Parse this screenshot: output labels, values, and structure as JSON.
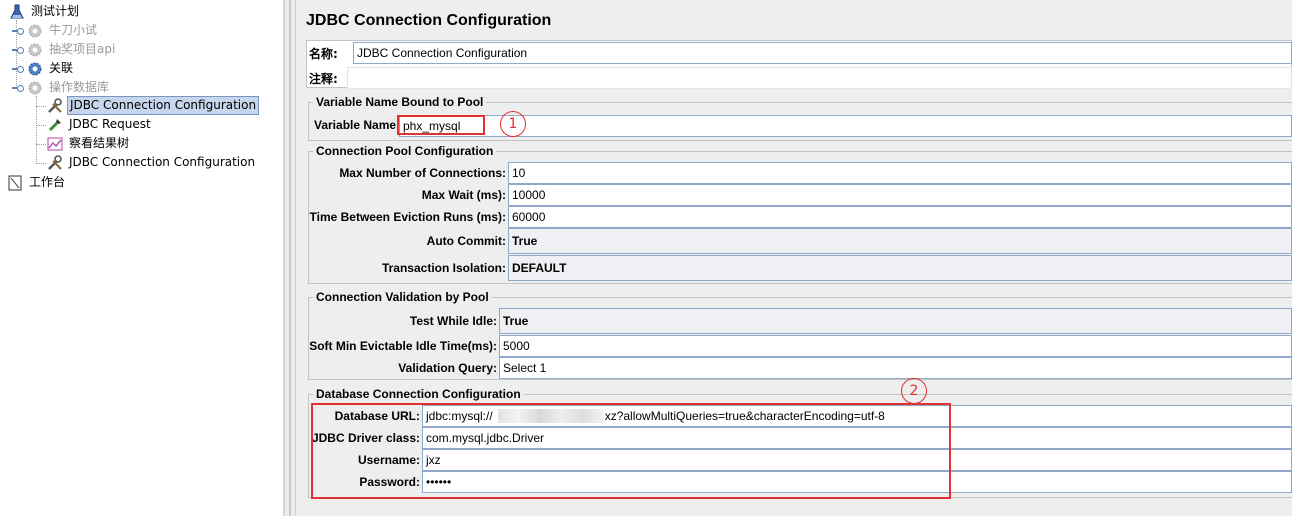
{
  "tree": {
    "root": "测试计划",
    "items": [
      {
        "label": "牛刀小试",
        "disabled": true
      },
      {
        "label": "抽奖项目api",
        "disabled": true
      },
      {
        "label": "关联",
        "disabled": false
      },
      {
        "label": "操作数据库",
        "disabled": true
      }
    ],
    "children": [
      {
        "label": "JDBC Connection Configuration",
        "selected": true
      },
      {
        "label": "JDBC Request",
        "selected": false
      },
      {
        "label": "察看结果树",
        "selected": false
      },
      {
        "label": "JDBC Connection Configuration",
        "selected": false
      }
    ],
    "workbench": "工作台"
  },
  "panel": {
    "title": "JDBC Connection Configuration",
    "name_label": "名称:",
    "name_value": "JDBC Connection Configuration",
    "comment_label": "注释:",
    "comment_value": ""
  },
  "pool_binding": {
    "title": "Variable Name Bound to Pool",
    "variable_label": "Variable Name:",
    "variable_value": "phx_mysql"
  },
  "pool_config": {
    "title": "Connection Pool Configuration",
    "rows": [
      {
        "label": "Max Number of Connections:",
        "value": "10"
      },
      {
        "label": "Max Wait (ms):",
        "value": "10000"
      },
      {
        "label": "Time Between Eviction Runs (ms):",
        "value": "60000"
      },
      {
        "label": "Auto Commit:",
        "value": "True"
      },
      {
        "label": "Transaction Isolation:",
        "value": "DEFAULT"
      }
    ]
  },
  "validation": {
    "title": "Connection Validation by Pool",
    "rows": [
      {
        "label": "Test While Idle:",
        "value": "True"
      },
      {
        "label": "Soft Min Evictable Idle Time(ms):",
        "value": "5000"
      },
      {
        "label": "Validation Query:",
        "value": "Select 1"
      }
    ]
  },
  "database": {
    "title": "Database Connection Configuration",
    "rows": [
      {
        "label": "Database URL:",
        "value_prefix": "jdbc:mysql://",
        "value_suffix": "/jxz?allowMultiQueries=true&characterEncoding=utf-8"
      },
      {
        "label": "JDBC Driver class:",
        "value": "com.mysql.jdbc.Driver"
      },
      {
        "label": "Username:",
        "value": "jxz"
      },
      {
        "label": "Password:",
        "value": "••••••"
      }
    ]
  },
  "annotations": {
    "one": "1",
    "two": "2",
    "color": "#e03232"
  }
}
